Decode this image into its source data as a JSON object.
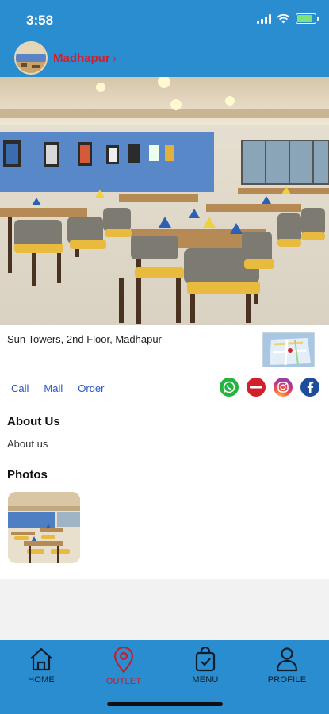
{
  "status_bar": {
    "time": "3:58",
    "battery_level": 0.8
  },
  "header": {
    "outlet_name": "Madhapur"
  },
  "outlet": {
    "address": "Sun Towers, 2nd Floor, Madhapur",
    "actions": {
      "call": "Call",
      "mail": "Mail",
      "order": "Order"
    },
    "socials": [
      "whatsapp-icon",
      "zomato-icon",
      "instagram-icon",
      "facebook-icon"
    ],
    "socials_colors": {
      "whatsapp": "#25b33d",
      "zomato": "#d11f2b",
      "instagram": "#e1306c",
      "facebook": "#1e4d9c"
    }
  },
  "about": {
    "heading": "About Us",
    "text": "About us"
  },
  "photos": {
    "heading": "Photos"
  },
  "bottom_nav": {
    "items": [
      {
        "label": "HOME",
        "icon": "home-icon"
      },
      {
        "label": "OUTLET",
        "icon": "location-pin-icon",
        "active": true
      },
      {
        "label": "MENU",
        "icon": "shopping-bag-icon"
      },
      {
        "label": "PROFILE",
        "icon": "user-icon"
      }
    ]
  },
  "colors": {
    "brand_blue": "#2a8dd0",
    "accent_red": "#d0202e",
    "link_blue": "#2a55c7"
  }
}
